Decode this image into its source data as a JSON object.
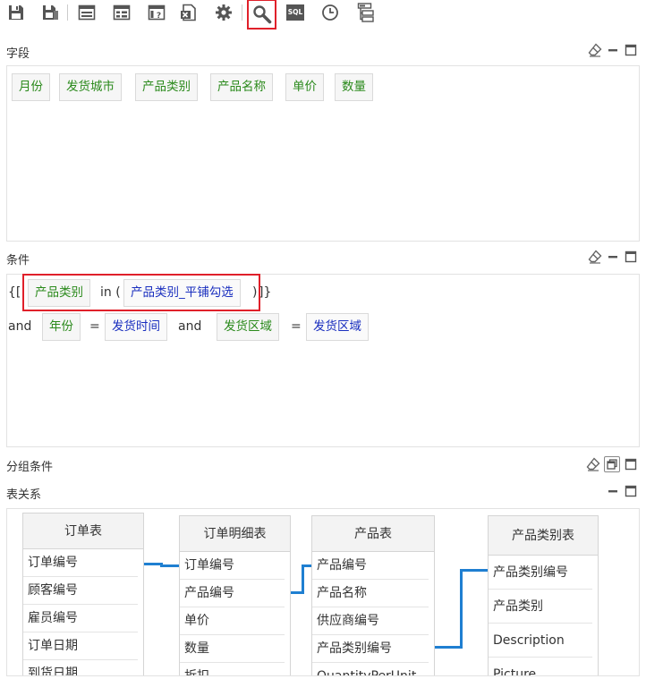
{
  "toolbar": {
    "items": [
      "save-icon",
      "save-as-icon",
      "layout-icon",
      "grid-icon",
      "help-template-icon",
      "excel-icon",
      "gear-icon",
      "search-icon",
      "sql-icon",
      "clock-icon",
      "tree-icon"
    ],
    "sql_label": "SQL",
    "accent": "#e0202a"
  },
  "fields": {
    "title": "字段",
    "chips": [
      "月份",
      "发货城市",
      "产品类别",
      "产品名称",
      "单价",
      "数量"
    ]
  },
  "conditions": {
    "title": "条件",
    "line1": {
      "open": "{[",
      "field": "产品类别",
      "op": "in (",
      "param": "产品类别_平铺勾选",
      "close": ")",
      "end": "]}"
    },
    "line2": {
      "and1": "and",
      "f1": "年份",
      "eq1": "=",
      "v1": "发货时间",
      "and2": "and",
      "f2": "发货区域",
      "eq2": "=",
      "v2": "发货区域"
    }
  },
  "group": {
    "title": "分组条件"
  },
  "relations": {
    "title": "表关系",
    "tables": [
      {
        "name": "订单表",
        "rows": [
          "订单编号",
          "顾客编号",
          "雇员编号",
          "订单日期",
          "到货日期"
        ]
      },
      {
        "name": "订单明细表",
        "rows": [
          "订单编号",
          "产品编号",
          "单价",
          "数量",
          "折扣"
        ]
      },
      {
        "name": "产品表",
        "rows": [
          "产品编号",
          "产品名称",
          "供应商编号",
          "产品类别编号",
          "QuantityPerUnit"
        ]
      },
      {
        "name": "产品类别表",
        "rows": [
          "产品类别编号",
          "产品类别",
          "Description",
          "Picture"
        ]
      }
    ],
    "link_color": "#1f7fd1"
  },
  "colors": {
    "field_green": "#2b8a1c",
    "param_blue": "#1a2fbf"
  }
}
